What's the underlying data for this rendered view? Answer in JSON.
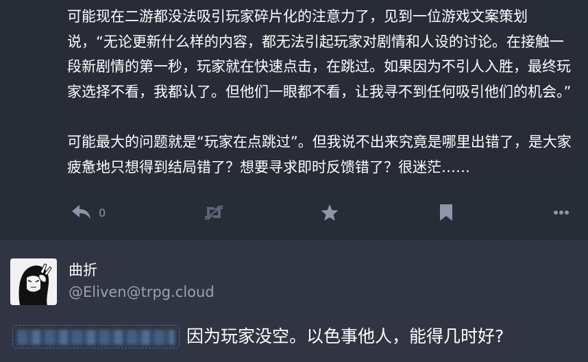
{
  "post1": {
    "paragraph1": "可能现在二游都没法吸引玩家碎片化的注意力了，见到一位游戏文案策划说，“无论更新什么样的内容，都无法引起玩家对剧情和人设的讨论。在接触一段新剧情的第一秒，玩家就在快速点击，在跳过。如果因为不引人入胜，最终玩家选择不看，我都认了。但他们一眼都不看，让我寻不到任何吸引他们的机会。”",
    "paragraph2": "可能最大的问题就是“玩家在点跳过”。但我说不出来究竟是哪里出错了，是大家疲惫地只想得到结局错了？想要寻求即时反馈错了？很迷茫……",
    "actions": {
      "reply_count": "0",
      "icons": [
        "reply-icon",
        "boost-disabled-icon",
        "favourite-icon",
        "bookmark-icon",
        "more-icon"
      ]
    }
  },
  "post2": {
    "display_name": "曲折",
    "handle": "@Eliven@trpg.cloud",
    "reply_text": "因为玩家没空。以色事他人，能得几时好?"
  },
  "colors": {
    "background": "#282c37",
    "reply_background": "#313543",
    "icon": "#8e96ab",
    "handle": "#9aa2b4",
    "mention_border": "#3a6fa8"
  }
}
